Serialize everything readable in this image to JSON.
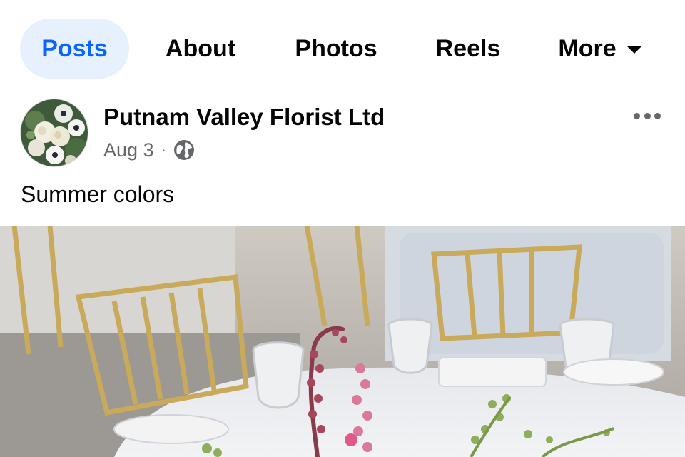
{
  "tabs": [
    {
      "label": "Posts",
      "active": true
    },
    {
      "label": "About",
      "active": false
    },
    {
      "label": "Photos",
      "active": false
    },
    {
      "label": "Reels",
      "active": false
    },
    {
      "label": "More",
      "active": false
    }
  ],
  "post": {
    "author": "Putnam Valley Florist Ltd",
    "date": "Aug 3",
    "separator": "·",
    "audience_icon": "globe-icon",
    "menu_icon": "more-horizontal-icon",
    "caption": "Summer colors"
  },
  "colors": {
    "accent": "#0866ff",
    "active_tab_bg": "#e7f0fd",
    "secondary_text": "#65676b",
    "primary_text": "#050505"
  }
}
